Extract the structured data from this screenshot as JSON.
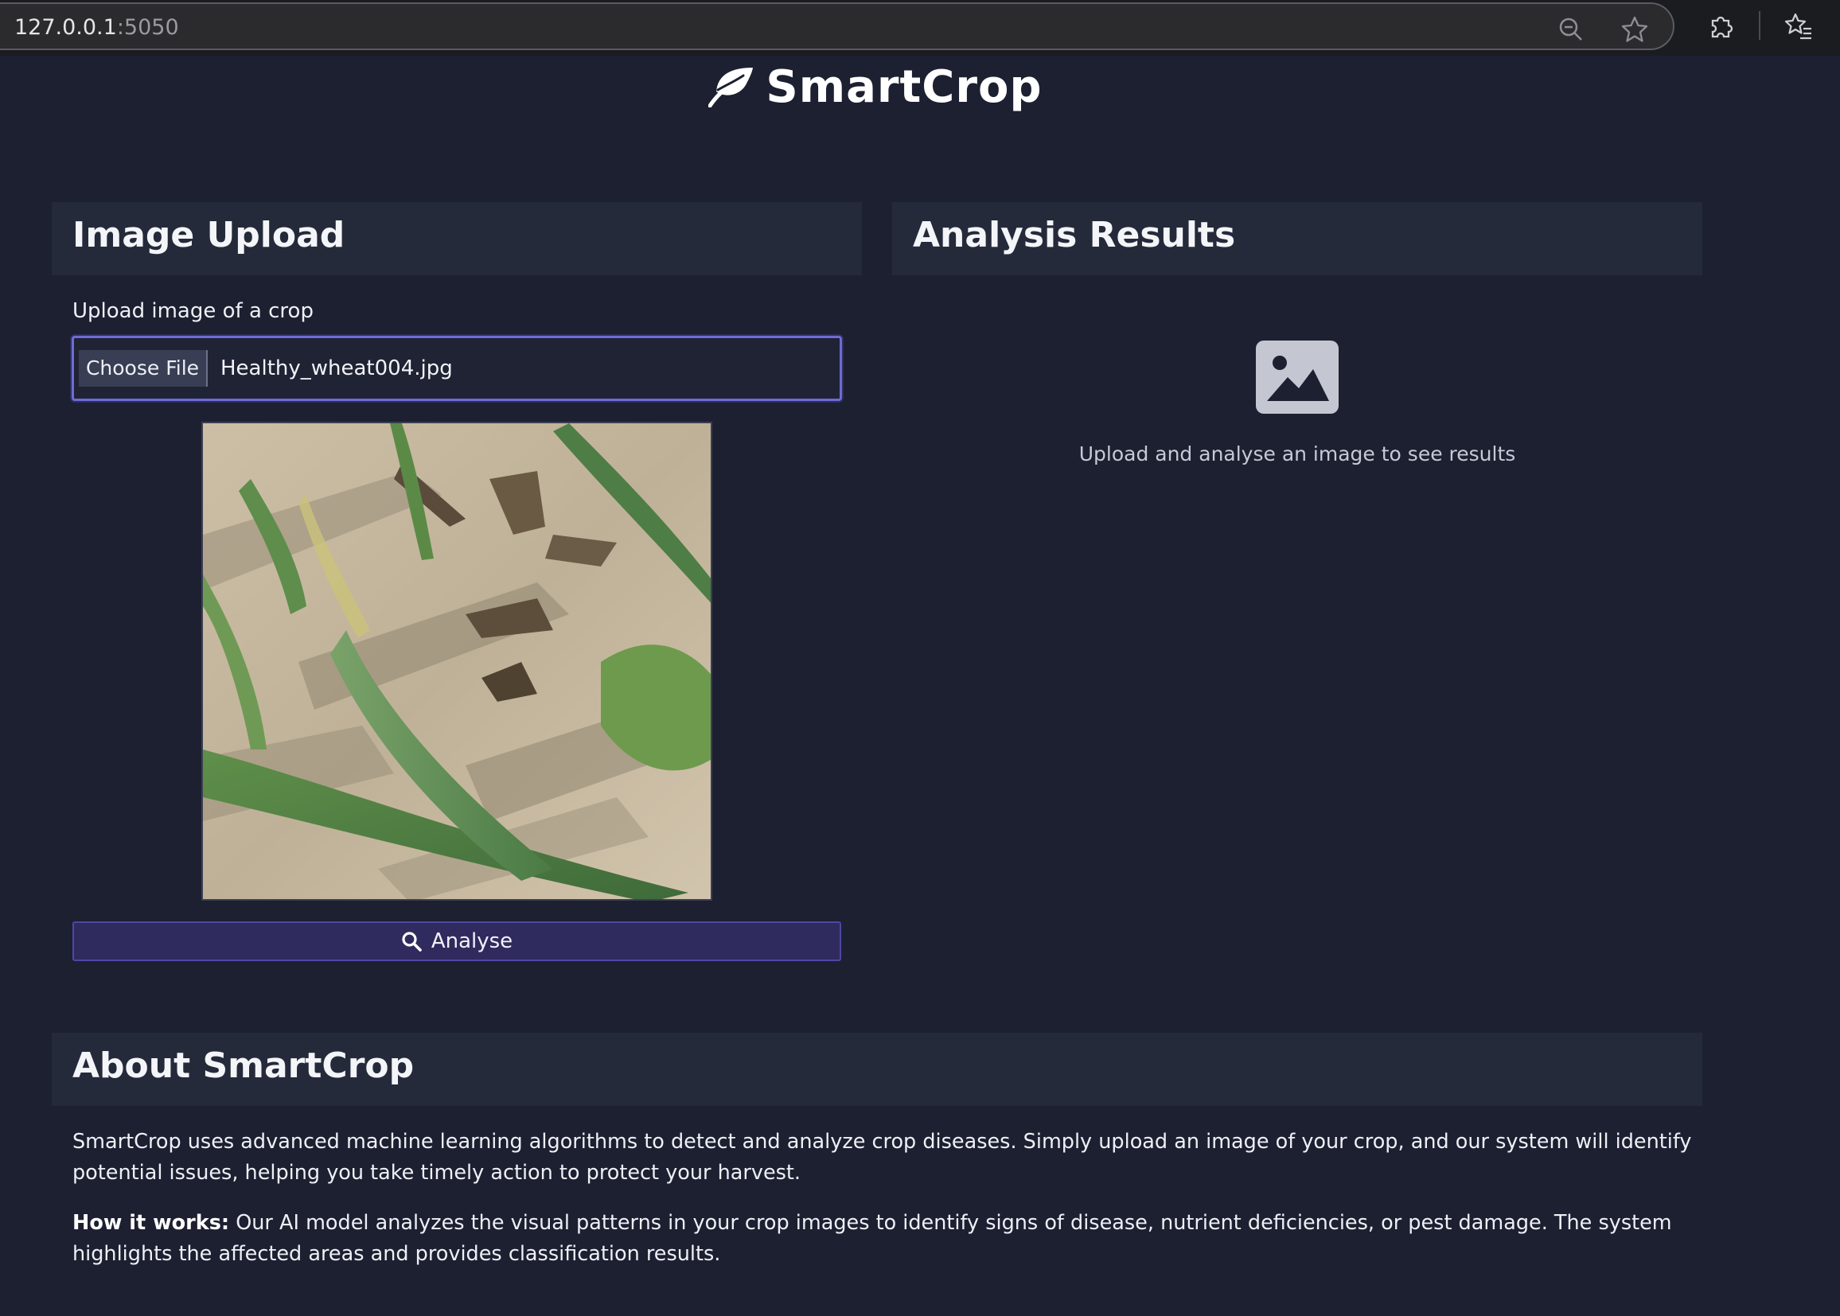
{
  "browser": {
    "url_host": "127.0.0.1",
    "url_port": ":5050"
  },
  "brand": {
    "name": "SmartCrop",
    "icon": "leaf-icon"
  },
  "upload_card": {
    "title": "Image Upload",
    "field_label": "Upload image of a crop",
    "choose_button": "Choose File",
    "file_name": "Healthy_wheat004.jpg",
    "analyse_button": "Analyse",
    "analyse_icon": "search-icon"
  },
  "results_card": {
    "title": "Analysis Results",
    "placeholder_icon": "image-icon",
    "hint": "Upload and analyse an image to see results"
  },
  "about": {
    "title": "About SmartCrop",
    "paragraph1": "SmartCrop uses advanced machine learning algorithms to detect and analyze crop diseases. Simply upload an image of your crop, and our system will identify potential issues, helping you take timely action to protect your harvest.",
    "how_label": "How it works:",
    "how_text": " Our AI model analyzes the visual patterns in your crop images to identify signs of disease, nutrient deficiencies, or pest damage. The system highlights the affected areas and provides classification results."
  },
  "colors": {
    "page_background": "#1c2031",
    "card_header": "#252a3b",
    "accent": "#302b5e"
  }
}
